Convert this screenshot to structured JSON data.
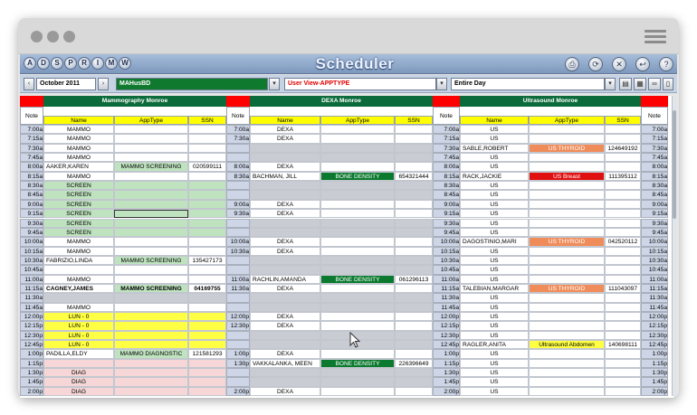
{
  "titlebar": {
    "app_title": "Scheduler",
    "module_buttons": [
      "A",
      "D",
      "S",
      "P",
      "R",
      "I",
      "M",
      "W"
    ],
    "tool_icons": [
      "print-icon",
      "refresh-icon",
      "tools-icon",
      "back-icon",
      "help-icon"
    ]
  },
  "controls": {
    "month": "October 2011",
    "provider": "MAHusBD",
    "view": "User View-APPTYPE",
    "range": "Entire Day",
    "toolbar_icons": [
      "image-icon",
      "calendar-icon",
      "binoculars-icon",
      "document-icon",
      "undo-icon"
    ]
  },
  "columns": {
    "note_label": "Note",
    "sections": [
      "Mammography Monroe",
      "DEXA Monroe",
      "Ultrasound Monroe"
    ],
    "headers": [
      "Name",
      "AppType",
      "SSN"
    ]
  },
  "times": [
    "7:00a",
    "7:15a",
    "7:30a",
    "7:45a",
    "8:00a",
    "8:15a",
    "8:30a",
    "8:45a",
    "9:00a",
    "9:15a",
    "9:30a",
    "9:45a",
    "10:00a",
    "10:15a",
    "10:30a",
    "10:45a",
    "11:00a",
    "11:15a",
    "11:30a",
    "11:45a",
    "12:00p",
    "12:15p",
    "12:30p",
    "12:45p",
    "1:00p",
    "1:15p",
    "1:30p",
    "1:45p",
    "2:00p"
  ],
  "mammo": [
    {
      "name": "MAMMO",
      "type": "",
      "ssn": ""
    },
    {
      "name": "MAMMO",
      "type": "",
      "ssn": ""
    },
    {
      "name": "MAMMO",
      "type": "",
      "ssn": ""
    },
    {
      "name": "MAMMO",
      "type": "",
      "ssn": ""
    },
    {
      "name": "AAKER,KAREN",
      "type": "MAMMO SCREENING",
      "ssn": "020599111"
    },
    {
      "name": "MAMMO",
      "type": "",
      "ssn": ""
    },
    {
      "name": "SCREEN",
      "type": "",
      "ssn": ""
    },
    {
      "name": "SCREEN",
      "type": "",
      "ssn": ""
    },
    {
      "name": "SCREEN",
      "type": "",
      "ssn": ""
    },
    {
      "name": "SCREEN",
      "type": "",
      "ssn": ""
    },
    {
      "name": "SCREEN",
      "type": "",
      "ssn": ""
    },
    {
      "name": "SCREEN",
      "type": "",
      "ssn": ""
    },
    {
      "name": "MAMMO",
      "type": "",
      "ssn": ""
    },
    {
      "name": "MAMMO",
      "type": "",
      "ssn": ""
    },
    {
      "name": "FABRIZIO,LINDA",
      "type": "MAMMO SCREENING",
      "ssn": "135427173"
    },
    {
      "name": "",
      "type": "",
      "ssn": ""
    },
    {
      "name": "MAMMO",
      "type": "",
      "ssn": ""
    },
    {
      "name": "CAGNEY,JAMES",
      "type": "MAMMO SCREENING",
      "ssn": "04169755"
    },
    {
      "name": "",
      "type": "",
      "ssn": ""
    },
    {
      "name": "MAMMO",
      "type": "",
      "ssn": ""
    },
    {
      "name": "LUN - 0",
      "type": "",
      "ssn": ""
    },
    {
      "name": "LUN - 0",
      "type": "",
      "ssn": ""
    },
    {
      "name": "LUN - 0",
      "type": "",
      "ssn": ""
    },
    {
      "name": "LUN - 0",
      "type": "",
      "ssn": ""
    },
    {
      "name": "PADILLA,ELDY",
      "type": "MAMMO DIAGNOSTIC",
      "ssn": "121581293"
    },
    {
      "name": "",
      "type": "",
      "ssn": ""
    },
    {
      "name": "DIAG",
      "type": "",
      "ssn": ""
    },
    {
      "name": "DIAG",
      "type": "",
      "ssn": ""
    },
    {
      "name": "DIAG",
      "type": "",
      "ssn": ""
    }
  ],
  "dexa": [
    {
      "name": "DEXA",
      "type": "",
      "ssn": ""
    },
    {
      "name": "DEXA",
      "type": "",
      "ssn": ""
    },
    {
      "name": "",
      "type": "",
      "ssn": ""
    },
    {
      "name": "",
      "type": "",
      "ssn": ""
    },
    {
      "name": "DEXA",
      "type": "",
      "ssn": ""
    },
    {
      "name": "BACHMAN, JILL",
      "type": "BONE DENSITY",
      "ssn": "654321444"
    },
    {
      "name": "",
      "type": "",
      "ssn": ""
    },
    {
      "name": "",
      "type": "",
      "ssn": ""
    },
    {
      "name": "DEXA",
      "type": "",
      "ssn": ""
    },
    {
      "name": "DEXA",
      "type": "",
      "ssn": ""
    },
    {
      "name": "",
      "type": "",
      "ssn": ""
    },
    {
      "name": "",
      "type": "",
      "ssn": ""
    },
    {
      "name": "DEXA",
      "type": "",
      "ssn": ""
    },
    {
      "name": "DEXA",
      "type": "",
      "ssn": ""
    },
    {
      "name": "",
      "type": "",
      "ssn": ""
    },
    {
      "name": "",
      "type": "",
      "ssn": ""
    },
    {
      "name": "RACHLIN,AMANDA",
      "type": "BONE DENSITY",
      "ssn": "061296113"
    },
    {
      "name": "DEXA",
      "type": "",
      "ssn": ""
    },
    {
      "name": "",
      "type": "",
      "ssn": ""
    },
    {
      "name": "",
      "type": "",
      "ssn": ""
    },
    {
      "name": "DEXA",
      "type": "",
      "ssn": ""
    },
    {
      "name": "DEXA",
      "type": "",
      "ssn": ""
    },
    {
      "name": "",
      "type": "",
      "ssn": ""
    },
    {
      "name": "",
      "type": "",
      "ssn": ""
    },
    {
      "name": "DEXA",
      "type": "",
      "ssn": ""
    },
    {
      "name": "VAKKALANKA, MEEN",
      "type": "BONE DENSITY",
      "ssn": "226396649"
    },
    {
      "name": "",
      "type": "",
      "ssn": ""
    },
    {
      "name": "",
      "type": "",
      "ssn": ""
    },
    {
      "name": "DEXA",
      "type": "",
      "ssn": ""
    }
  ],
  "dexa_times": [
    "7:00a",
    "7:30a",
    "",
    "",
    "8:00a",
    "8:30a",
    "",
    "",
    "9:00a",
    "9:30a",
    "",
    "",
    "10:00a",
    "10:30a",
    "",
    "",
    "11:00a",
    "11:30a",
    "",
    "",
    "12:00p",
    "12:30p",
    "",
    "",
    "1:00p",
    "1:30p",
    "",
    "",
    "2:00p"
  ],
  "us": [
    {
      "name": "US",
      "type": "",
      "ssn": ""
    },
    {
      "name": "US",
      "type": "",
      "ssn": ""
    },
    {
      "name": "SABLE,ROBERT",
      "type": "US THYROID",
      "ssn": "124649192"
    },
    {
      "name": "US",
      "type": "",
      "ssn": ""
    },
    {
      "name": "US",
      "type": "",
      "ssn": ""
    },
    {
      "name": "RACK,JACKIE",
      "type": "US Breast",
      "ssn": "111395112"
    },
    {
      "name": "US",
      "type": "",
      "ssn": ""
    },
    {
      "name": "US",
      "type": "",
      "ssn": ""
    },
    {
      "name": "US",
      "type": "",
      "ssn": ""
    },
    {
      "name": "US",
      "type": "",
      "ssn": ""
    },
    {
      "name": "US",
      "type": "",
      "ssn": ""
    },
    {
      "name": "US",
      "type": "",
      "ssn": ""
    },
    {
      "name": "DAGOSTINIO,MARI",
      "type": "US THYROID",
      "ssn": "042520112"
    },
    {
      "name": "US",
      "type": "",
      "ssn": ""
    },
    {
      "name": "US",
      "type": "",
      "ssn": ""
    },
    {
      "name": "US",
      "type": "",
      "ssn": ""
    },
    {
      "name": "US",
      "type": "",
      "ssn": ""
    },
    {
      "name": "TALEBIAN,MARGAR",
      "type": "US THYROID",
      "ssn": "111043097"
    },
    {
      "name": "US",
      "type": "",
      "ssn": ""
    },
    {
      "name": "US",
      "type": "",
      "ssn": ""
    },
    {
      "name": "US",
      "type": "",
      "ssn": ""
    },
    {
      "name": "US",
      "type": "",
      "ssn": ""
    },
    {
      "name": "US",
      "type": "",
      "ssn": ""
    },
    {
      "name": "RAGLER,ANITA",
      "type": "Ultrasound Abdomen",
      "ssn": "140698111"
    },
    {
      "name": "US",
      "type": "",
      "ssn": ""
    },
    {
      "name": "US",
      "type": "",
      "ssn": ""
    },
    {
      "name": "US",
      "type": "",
      "ssn": ""
    },
    {
      "name": "US",
      "type": "",
      "ssn": ""
    },
    {
      "name": "US",
      "type": "",
      "ssn": ""
    }
  ],
  "colors": {
    "section_header": "#0b6b3a",
    "col_header": "#ffff00",
    "time_bg": "#cdd5e6",
    "screen_green": "#bfe3bf",
    "lunch_yellow": "#ffff44",
    "diag_pink": "#f6d6d6",
    "gray_block": "#c9ccd2",
    "bone_green": "#0b7a2e",
    "thyroid_orange": "#f08c5a",
    "breast_red": "#e01010",
    "note_red": "#ff0000"
  }
}
